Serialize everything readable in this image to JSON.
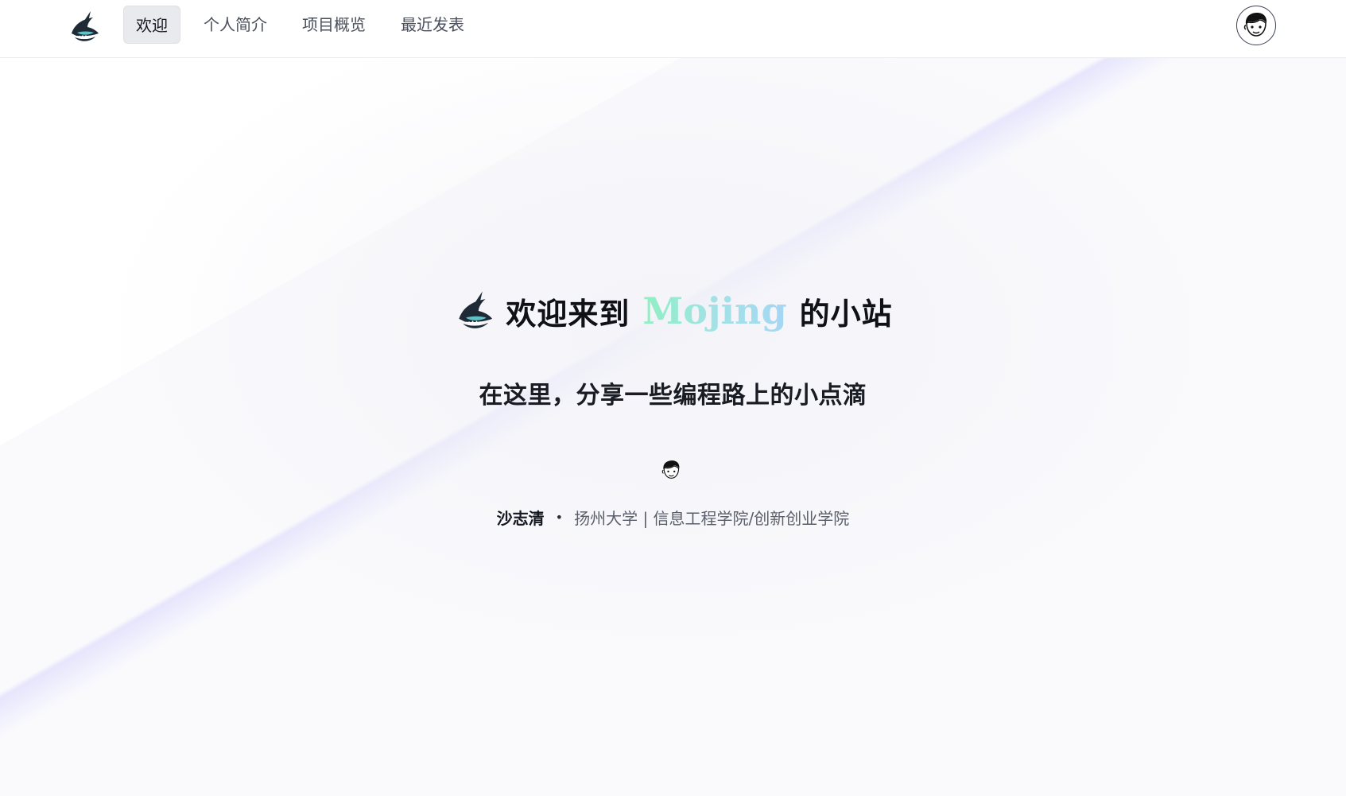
{
  "nav": {
    "logo_icon": "shark-logo-icon",
    "items": [
      {
        "label": "欢迎",
        "active": true
      },
      {
        "label": "个人简介",
        "active": false
      },
      {
        "label": "项目概览",
        "active": false
      },
      {
        "label": "最近发表",
        "active": false
      }
    ],
    "avatar_icon": "user-avatar-icon"
  },
  "hero": {
    "logo_icon": "shark-logo-icon",
    "title_prefix": "欢迎来到",
    "title_brand": "Mojing",
    "title_suffix": "的小站",
    "subtitle": "在这里，分享一些编程路上的小点滴"
  },
  "author": {
    "avatar_icon": "cartoon-face-icon",
    "name": "沙志清",
    "separator": "•",
    "affiliation": "扬州大学 | 信息工程学院/创新创业学院"
  },
  "colors": {
    "brand_gradient_start": "#8ff0c2",
    "brand_gradient_end": "#a6d6f3",
    "active_tab_bg": "#e9eaee",
    "text_dark": "#151821",
    "text_muted": "#5a5f6b"
  }
}
